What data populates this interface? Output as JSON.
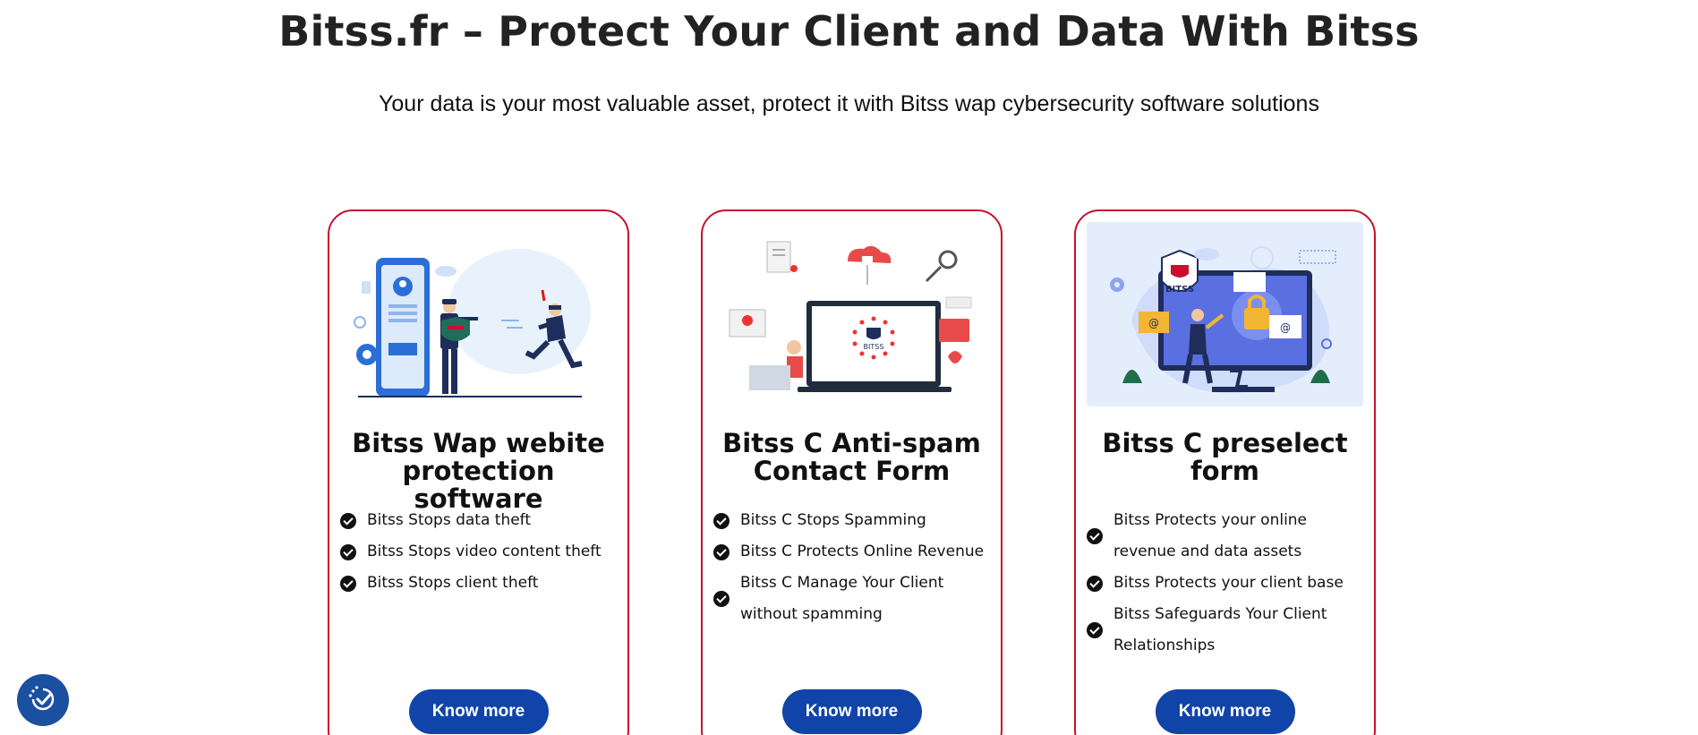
{
  "hero": {
    "title": "Bitss.fr – Protect Your Client and Data With Bitss",
    "subtitle": "Your data is your most valuable asset, protect it with Bitss wap cybersecurity software solutions"
  },
  "cards": [
    {
      "title": "Bitss Wap webite protection software",
      "illustration": "phone-security-guard-thief-illustration",
      "features": [
        "Bitss Stops data theft",
        "Bitss Stops video content theft",
        "Bitss Stops client theft"
      ],
      "button": "Know more"
    },
    {
      "title": "Bitss C Anti-spam Contact Form",
      "illustration": "laptop-cloud-security-illustration",
      "illustration_label": "BITSS",
      "features": [
        "Bitss C Stops Spamming",
        "Bitss C Protects Online Revenue",
        "Bitss C Manage Your Client without spamming"
      ],
      "button": "Know more"
    },
    {
      "title": "Bitss C preselect form",
      "illustration": "monitor-padlock-shield-illustration",
      "illustration_label": "BITSS",
      "features": [
        "Bitss Protects your online revenue and data assets",
        "Bitss Protects your client base",
        "Bitss Safeguards Your Client Relationships"
      ],
      "button": "Know more"
    }
  ],
  "colors": {
    "card_border": "#c8102e",
    "button_bg": "#1044a8",
    "a11y_button_bg": "#1b4fa0"
  },
  "accessibility": {
    "icon": "accessibility-check-icon"
  }
}
